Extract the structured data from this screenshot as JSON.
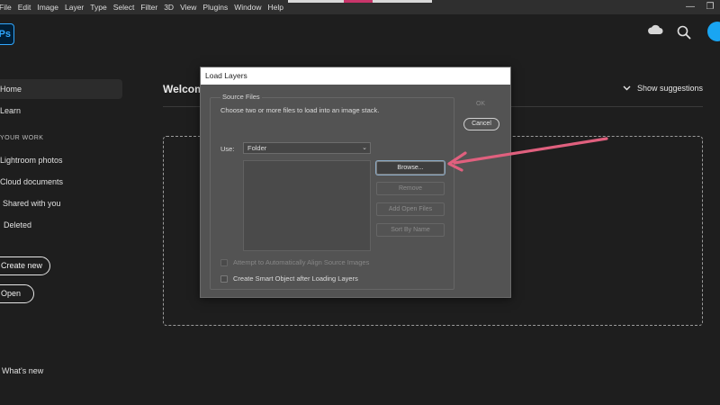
{
  "menu": [
    "File",
    "Edit",
    "Image",
    "Layer",
    "Type",
    "Select",
    "Filter",
    "3D",
    "View",
    "Plugins",
    "Window",
    "Help"
  ],
  "window_controls": {
    "minimize": "—",
    "restore": "❐"
  },
  "app": {
    "logo_text": "Ps"
  },
  "sidebar": {
    "items": [
      {
        "label": "Home",
        "active": true
      },
      {
        "label": "Learn",
        "active": false
      }
    ],
    "section_label": "YOUR WORK",
    "work_items": [
      "Lightroom photos",
      "Cloud documents",
      "Shared with you",
      "Deleted"
    ],
    "create_new": "Create new",
    "open": "Open",
    "whats_new": "What's new"
  },
  "main": {
    "welcome": "Welcom",
    "show_suggestions": "Show suggestions",
    "dropzone_text": "."
  },
  "dialog": {
    "title": "Load Layers",
    "group_label": "Source Files",
    "instructions": "Choose two or more files to load into an image stack.",
    "use_label": "Use:",
    "use_value": "Folder",
    "buttons": {
      "browse": "Browse...",
      "remove": "Remove",
      "add_open_files": "Add Open Files",
      "sort_by_name": "Sort By Name"
    },
    "ok": "OK",
    "cancel": "Cancel",
    "checkbox_align": "Attempt to Automatically Align Source Images",
    "checkbox_smart": "Create Smart Object after Loading Layers"
  },
  "colors": {
    "accent_blue": "#31a8ff",
    "annotation_arrow": "#e0607e"
  }
}
